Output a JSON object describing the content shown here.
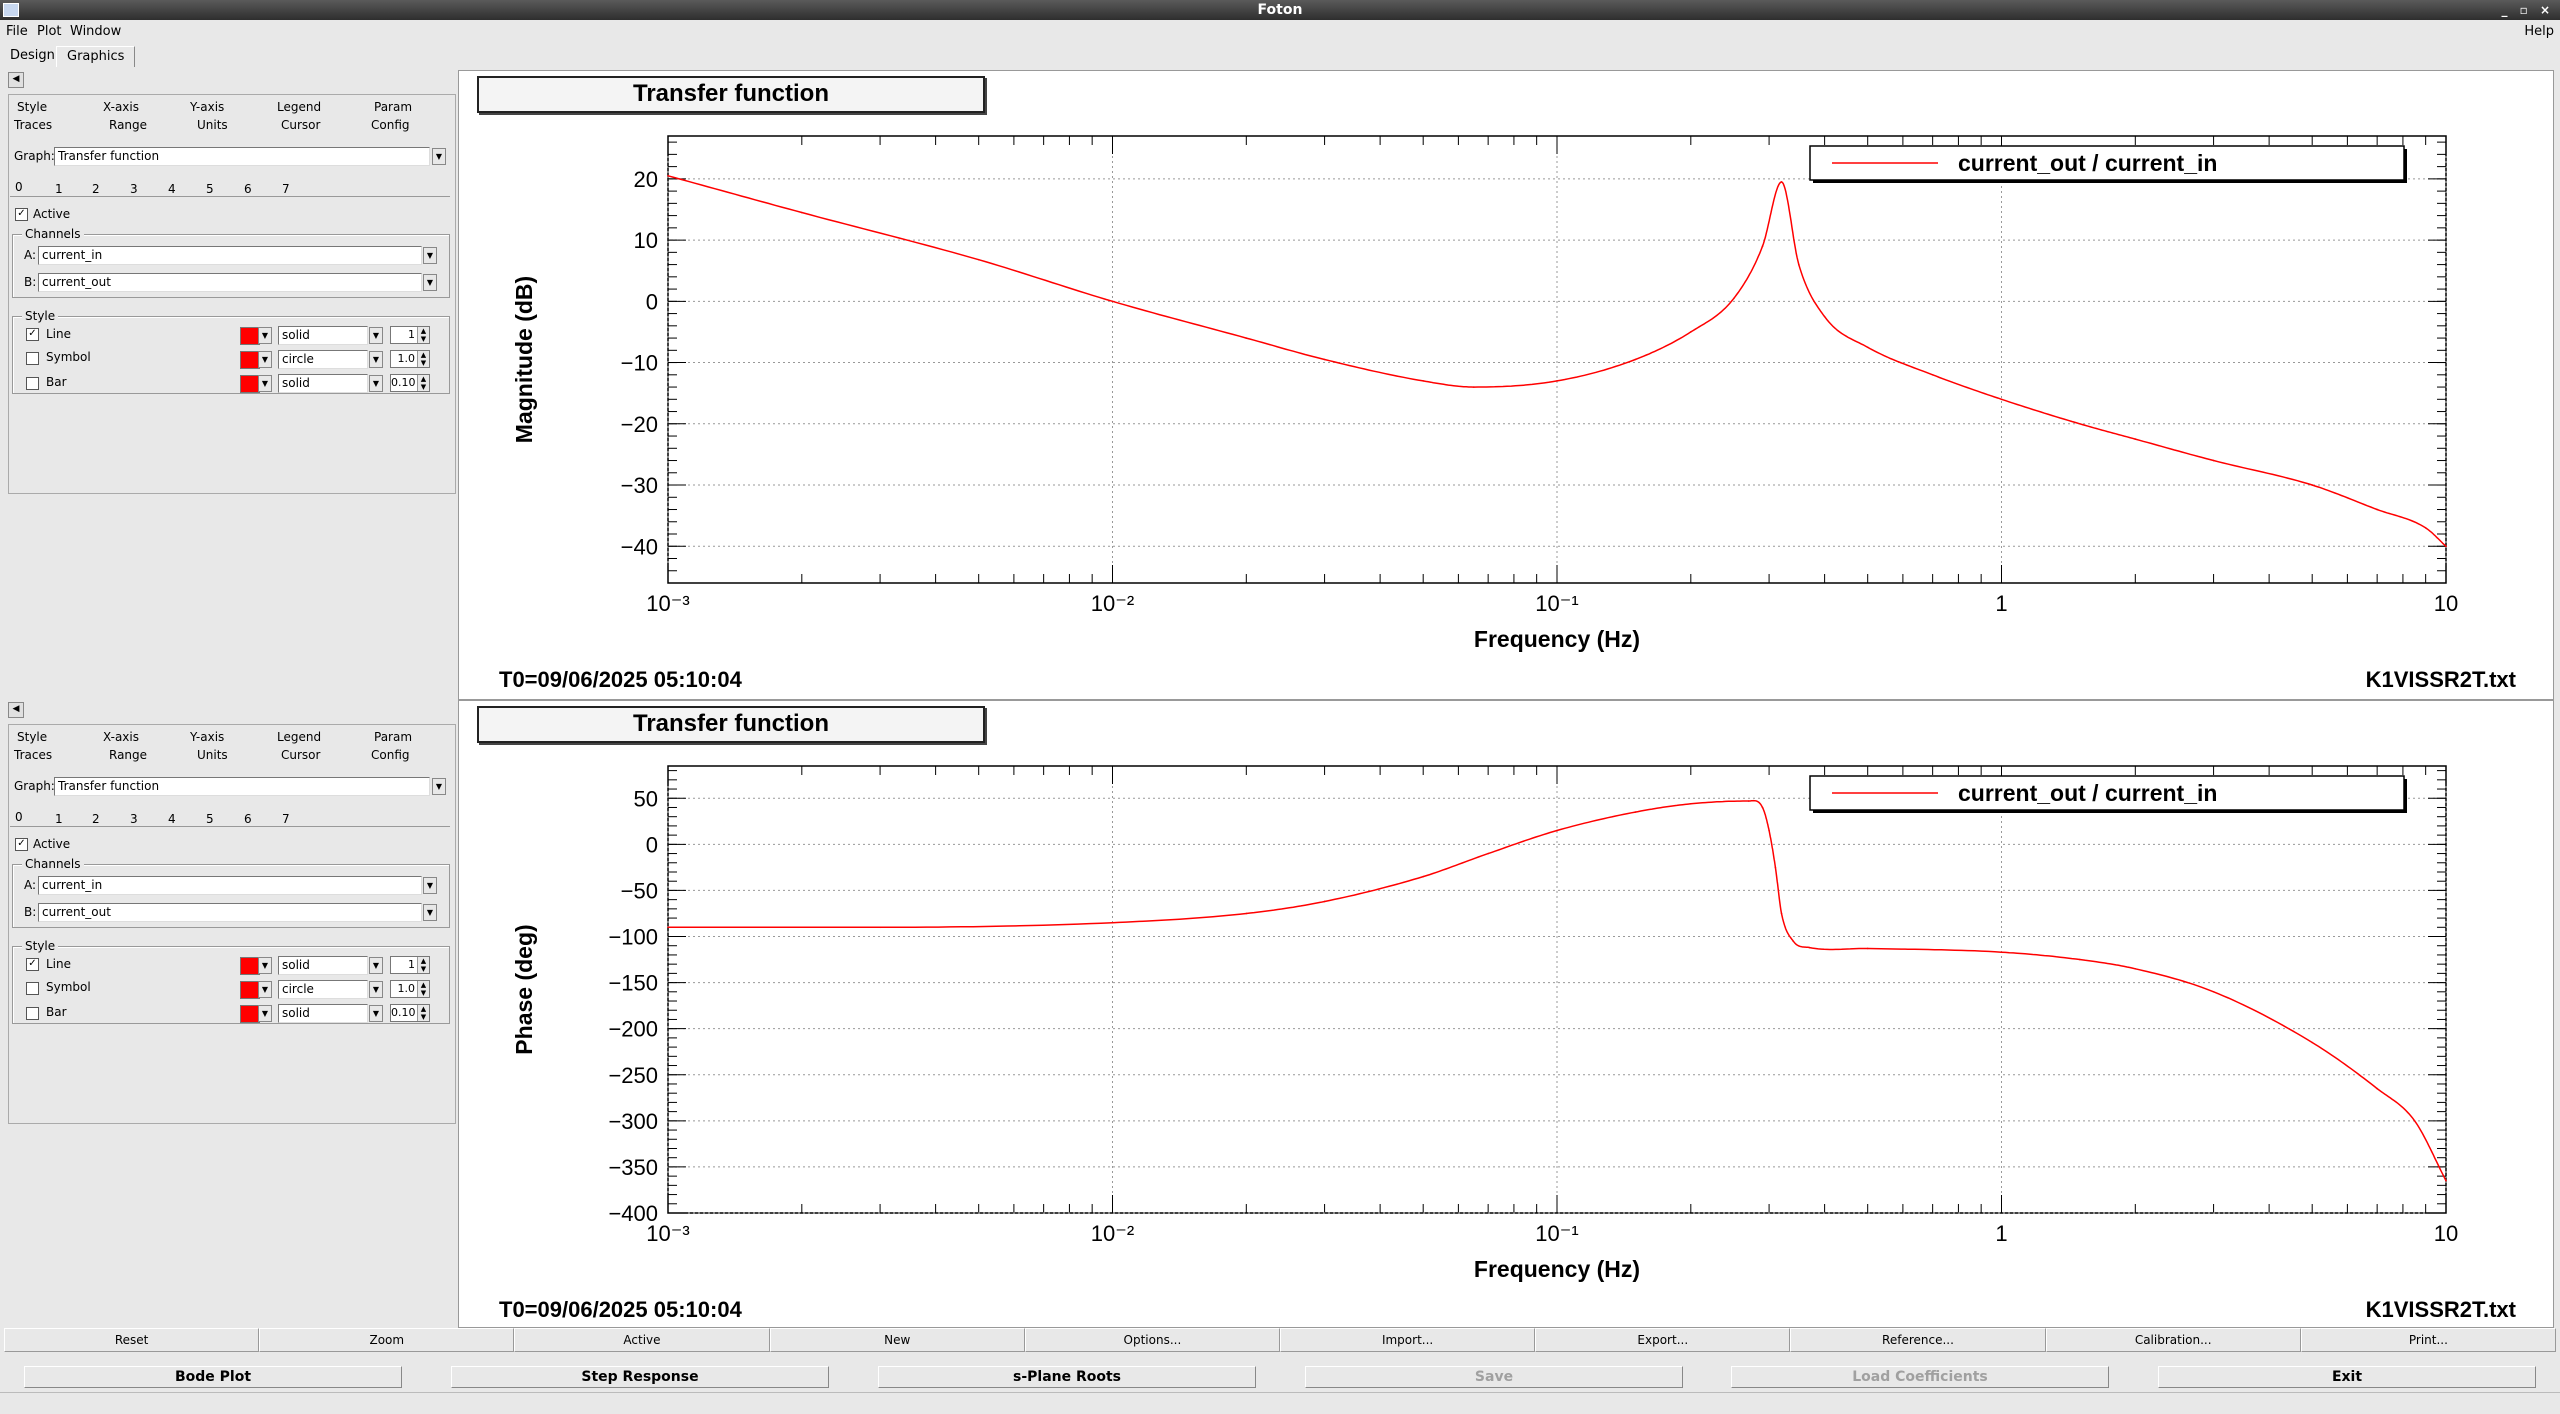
{
  "window": {
    "title": "Foton",
    "help": "Help",
    "controls": "_ ▫ ×"
  },
  "menu": {
    "file": "File",
    "plot": "Plot",
    "window": "Window"
  },
  "tabs": {
    "design": "Design",
    "graphics": "Graphics"
  },
  "panels": [
    {
      "collapse": "◀",
      "top_tabs": [
        "Style",
        "X-axis",
        "Y-axis",
        "Legend",
        "Param"
      ],
      "bottom_tabs": [
        "Traces",
        "Range",
        "Units",
        "Cursor",
        "Config"
      ],
      "graph_label": "Graph:",
      "graph_value": "Transfer function",
      "trace_tabs": [
        "0",
        "1",
        "2",
        "3",
        "4",
        "5",
        "6",
        "7"
      ],
      "active_label": "Active",
      "channels_label": "Channels",
      "a_label": "A:",
      "a_value": "current_in",
      "b_label": "B:",
      "b_value": "current_out",
      "style_label": "Style",
      "line_label": "Line",
      "line_style": "solid",
      "line_width": "1",
      "symbol_label": "Symbol",
      "symbol_style": "circle",
      "symbol_size": "1.0",
      "bar_label": "Bar",
      "bar_style": "solid",
      "bar_width": "0.10"
    },
    {
      "collapse": "◀",
      "top_tabs": [
        "Style",
        "X-axis",
        "Y-axis",
        "Legend",
        "Param"
      ],
      "bottom_tabs": [
        "Traces",
        "Range",
        "Units",
        "Cursor",
        "Config"
      ],
      "graph_label": "Graph:",
      "graph_value": "Transfer function",
      "trace_tabs": [
        "0",
        "1",
        "2",
        "3",
        "4",
        "5",
        "6",
        "7"
      ],
      "active_label": "Active",
      "channels_label": "Channels",
      "a_label": "A:",
      "a_value": "current_in",
      "b_label": "B:",
      "b_value": "current_out",
      "style_label": "Style",
      "line_label": "Line",
      "line_style": "solid",
      "line_width": "1",
      "symbol_label": "Symbol",
      "symbol_style": "circle",
      "symbol_size": "1.0",
      "bar_label": "Bar",
      "bar_style": "solid",
      "bar_width": "0.10"
    }
  ],
  "plots": [
    {
      "title": "Transfer function",
      "t0": "T0=09/06/2025 05:10:04",
      "file": "K1VISSR2T.txt"
    },
    {
      "title": "Transfer function",
      "t0": "T0=09/06/2025 05:10:04",
      "file": "K1VISSR2T.txt"
    }
  ],
  "buttons_row1": [
    "Reset",
    "Zoom",
    "Active",
    "New",
    "Options...",
    "Import...",
    "Export...",
    "Reference...",
    "Calibration...",
    "Print..."
  ],
  "buttons_row2": [
    {
      "label": "Bode Plot",
      "enabled": true
    },
    {
      "label": "Step Response",
      "enabled": true
    },
    {
      "label": "s-Plane Roots",
      "enabled": true
    },
    {
      "label": "Save",
      "enabled": false
    },
    {
      "label": "Load Coefficients",
      "enabled": false
    },
    {
      "label": "Exit",
      "enabled": true
    }
  ],
  "colors": {
    "trace": "#ff0000",
    "grid": "#999999",
    "background": "#e8e8e8"
  },
  "chart_data": [
    {
      "type": "line",
      "title": "Transfer function",
      "xlabel": "Frequency (Hz)",
      "ylabel": "Magnitude (dB)",
      "xscale": "log",
      "xlim": [
        0.001,
        10
      ],
      "ylim": [
        -46,
        27
      ],
      "xticks": [
        "10⁻³",
        "10⁻²",
        "10⁻¹",
        "1",
        "10"
      ],
      "yticks": [
        20,
        10,
        0,
        -10,
        -20,
        -30,
        -40
      ],
      "grid": true,
      "legend_position": "top-right",
      "series": [
        {
          "name": "current_out / current_in",
          "x": [
            0.001,
            0.002,
            0.005,
            0.01,
            0.02,
            0.03,
            0.05,
            0.065,
            0.1,
            0.15,
            0.2,
            0.25,
            0.29,
            0.32,
            0.35,
            0.4,
            0.5,
            0.7,
            1,
            1.5,
            2,
            3,
            5,
            7,
            9,
            10
          ],
          "y": [
            20.5,
            14.5,
            6.8,
            0,
            -6,
            -9.5,
            -13,
            -14,
            -13,
            -9.5,
            -5,
            0.5,
            9,
            19.5,
            6,
            -2.5,
            -7.5,
            -12,
            -16,
            -20,
            -22.5,
            -26,
            -30,
            -34,
            -37,
            -40
          ]
        }
      ]
    },
    {
      "type": "line",
      "title": "Transfer function",
      "xlabel": "Frequency (Hz)",
      "ylabel": "Phase (deg)",
      "xscale": "log",
      "xlim": [
        0.001,
        10
      ],
      "ylim": [
        -400,
        85
      ],
      "xticks": [
        "10⁻³",
        "10⁻²",
        "10⁻¹",
        "1",
        "10"
      ],
      "yticks": [
        50,
        0,
        -50,
        -100,
        -150,
        -200,
        -250,
        -300,
        -350,
        -400
      ],
      "grid": true,
      "legend_position": "top-right",
      "series": [
        {
          "name": "current_out / current_in",
          "x": [
            0.001,
            0.003,
            0.01,
            0.02,
            0.03,
            0.05,
            0.07,
            0.1,
            0.15,
            0.2,
            0.27,
            0.29,
            0.3,
            0.31,
            0.32,
            0.34,
            0.37,
            0.5,
            1,
            1.5,
            2,
            3,
            5,
            7,
            8.5,
            10
          ],
          "y": [
            -90,
            -90,
            -85,
            -75,
            -62,
            -35,
            -10,
            15,
            35,
            44,
            47,
            40,
            15,
            -25,
            -75,
            -105,
            -112,
            -113,
            -117,
            -125,
            -135,
            -160,
            -215,
            -265,
            -300,
            -365
          ]
        }
      ]
    }
  ]
}
